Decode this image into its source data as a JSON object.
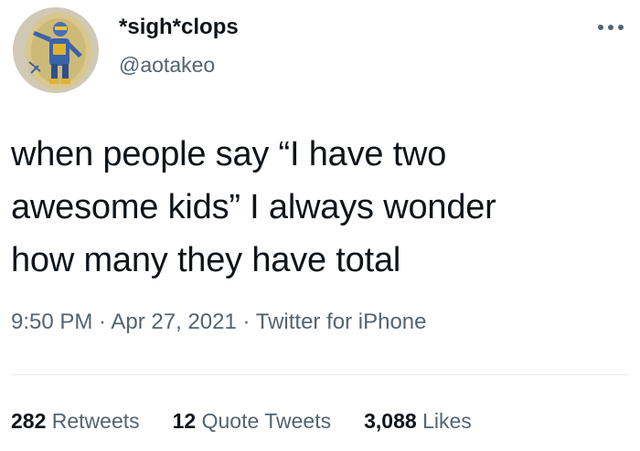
{
  "user": {
    "display_name": "*sigh*clops",
    "handle": "@aotakeo"
  },
  "tweet": {
    "lines": [
      "when people say “I have two",
      "awesome kids” I always wonder",
      "how many they have total"
    ],
    "time": "9:50 PM",
    "separator": " · ",
    "date": "Apr 27, 2021",
    "source": "Twitter for iPhone"
  },
  "stats": {
    "retweets_count": "282",
    "retweets_label": " Retweets",
    "quotes_count": "12",
    "quotes_label": " Quote Tweets",
    "likes_count": "3,088",
    "likes_label": " Likes"
  },
  "icons": {
    "more": "more-horizontal-icon"
  },
  "colors": {
    "text_primary": "#0f1419",
    "text_secondary": "#536471",
    "divider": "#e6ecf0"
  }
}
